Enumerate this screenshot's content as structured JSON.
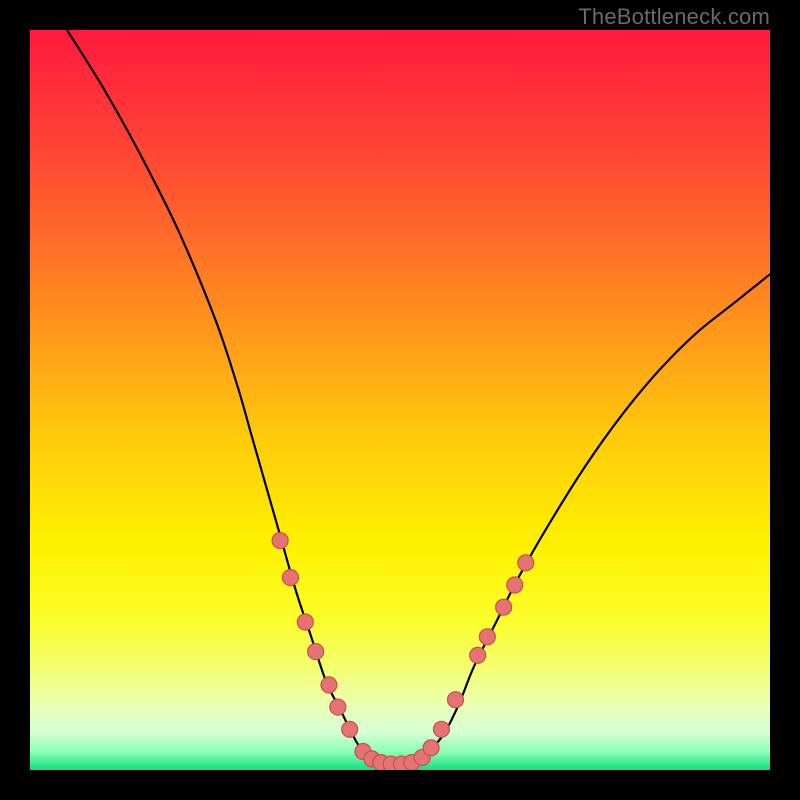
{
  "attribution": "TheBottleneck.com",
  "chart_data": {
    "type": "line",
    "title": "",
    "xlabel": "",
    "ylabel": "",
    "xlim": [
      0,
      100
    ],
    "ylim": [
      0,
      100
    ],
    "grid": false,
    "legend": false,
    "background_gradient_stops": [
      {
        "offset": 0.0,
        "color": "#ff1a3e"
      },
      {
        "offset": 0.18,
        "color": "#ff4a33"
      },
      {
        "offset": 0.38,
        "color": "#ff8d1f"
      },
      {
        "offset": 0.55,
        "color": "#ffcb0c"
      },
      {
        "offset": 0.7,
        "color": "#fff200"
      },
      {
        "offset": 0.8,
        "color": "#fafe2e"
      },
      {
        "offset": 0.86,
        "color": "#f4ff6e"
      },
      {
        "offset": 0.91,
        "color": "#ecffb0"
      },
      {
        "offset": 0.95,
        "color": "#d6ffd6"
      },
      {
        "offset": 0.975,
        "color": "#8cffb8"
      },
      {
        "offset": 1.0,
        "color": "#11e07f"
      }
    ],
    "series": [
      {
        "name": "bottleneck-curve",
        "color": "#000000",
        "x": [
          5,
          10,
          15,
          20,
          25,
          28,
          30,
          32,
          34,
          36,
          38,
          40,
          42,
          44,
          45,
          46,
          47,
          48,
          50,
          52,
          53,
          54,
          56,
          58,
          60,
          63,
          66,
          70,
          75,
          80,
          85,
          90,
          95,
          100
        ],
        "y": [
          100,
          92,
          83,
          73,
          61,
          52,
          45,
          38,
          31,
          24,
          18,
          12,
          8,
          4,
          2.5,
          1.5,
          1,
          0.8,
          0.8,
          1,
          1.5,
          2.5,
          5,
          9,
          14,
          20,
          26,
          33,
          41,
          48,
          54,
          59,
          63,
          67
        ]
      }
    ],
    "scatter": [
      {
        "name": "curve-markers",
        "color": "#e57373",
        "stroke": "#c84f4f",
        "radius": 8,
        "points": [
          {
            "x": 33.8,
            "y": 31
          },
          {
            "x": 35.2,
            "y": 26
          },
          {
            "x": 37.2,
            "y": 20
          },
          {
            "x": 38.6,
            "y": 16
          },
          {
            "x": 40.4,
            "y": 11.5
          },
          {
            "x": 41.6,
            "y": 8.5
          },
          {
            "x": 43.2,
            "y": 5.5
          },
          {
            "x": 45.0,
            "y": 2.5
          },
          {
            "x": 46.2,
            "y": 1.5
          },
          {
            "x": 47.4,
            "y": 1.0
          },
          {
            "x": 48.8,
            "y": 0.8
          },
          {
            "x": 50.2,
            "y": 0.8
          },
          {
            "x": 51.6,
            "y": 1.0
          },
          {
            "x": 53.0,
            "y": 1.7
          },
          {
            "x": 54.2,
            "y": 3.0
          },
          {
            "x": 55.6,
            "y": 5.5
          },
          {
            "x": 57.5,
            "y": 9.5
          },
          {
            "x": 60.5,
            "y": 15.5
          },
          {
            "x": 61.8,
            "y": 18
          },
          {
            "x": 64.0,
            "y": 22
          },
          {
            "x": 65.5,
            "y": 25
          },
          {
            "x": 67.0,
            "y": 28
          }
        ]
      }
    ]
  }
}
